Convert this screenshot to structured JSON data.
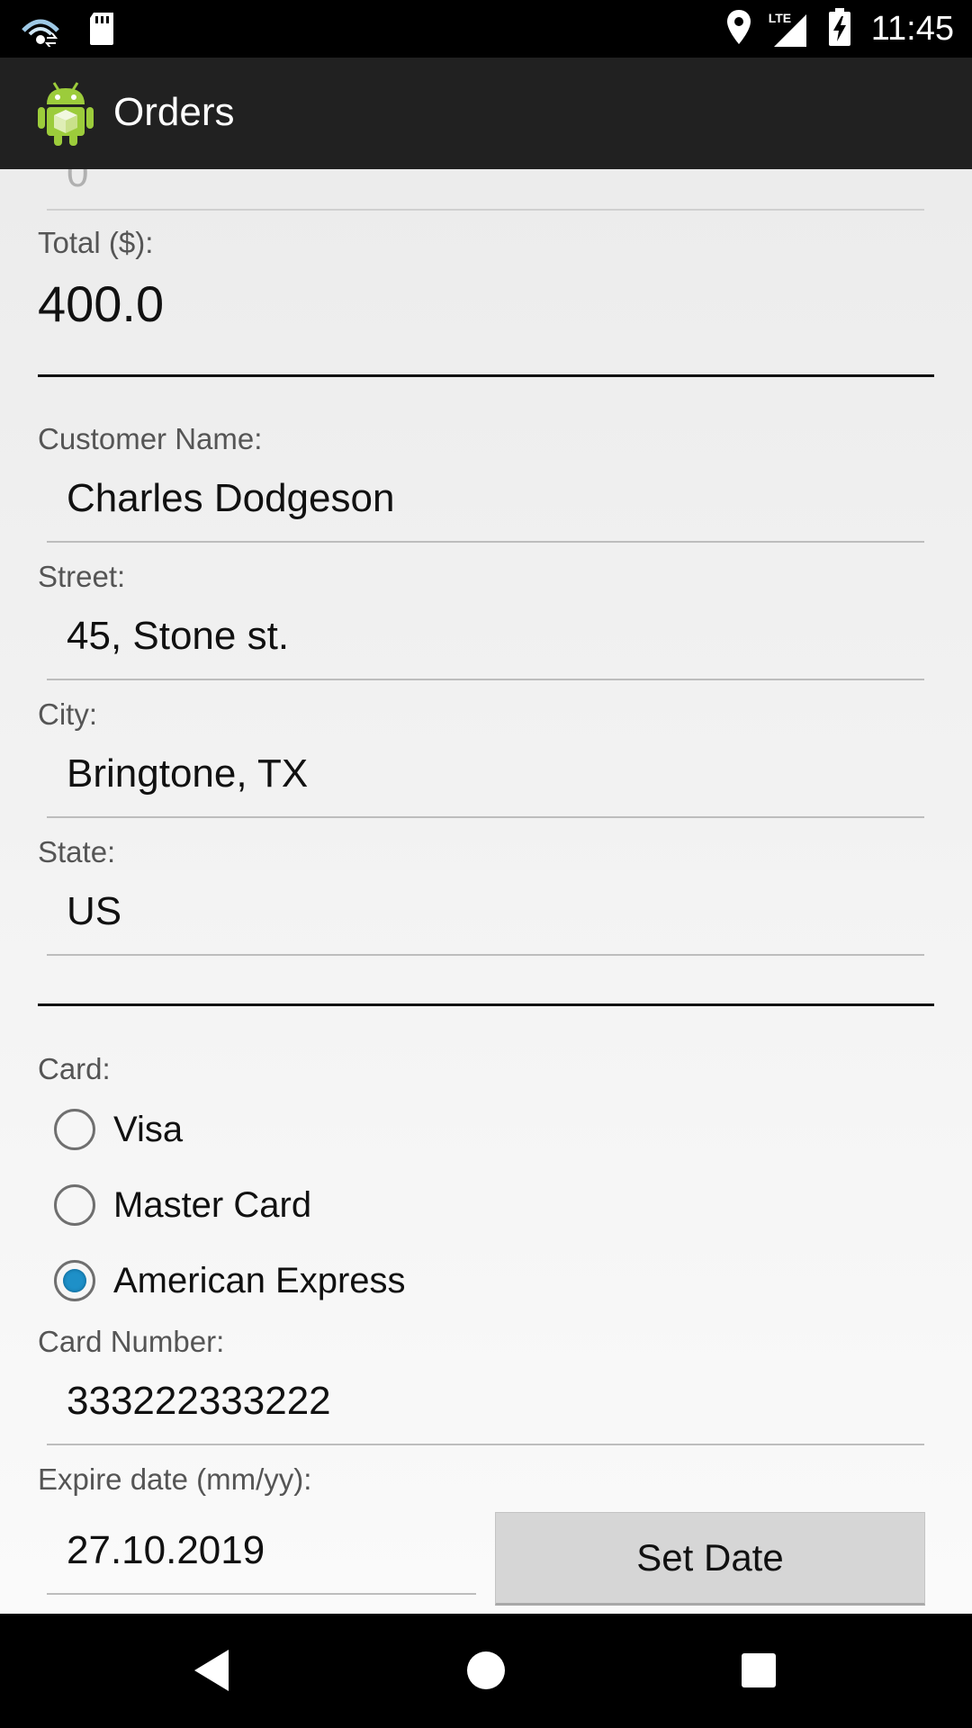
{
  "status_bar": {
    "time": "11:45",
    "network_label": "LTE",
    "icons": [
      "wifi-sync-icon",
      "sd-card-icon",
      "location-icon",
      "signal-icon",
      "battery-charging-icon"
    ]
  },
  "app_bar": {
    "title": "Orders",
    "app_icon": "android-package-icon"
  },
  "form": {
    "partial_field_value": "0",
    "total_label": "Total ($):",
    "total_value": "400.0",
    "customer_name_label": "Customer Name:",
    "customer_name_value": "Charles Dodgeson",
    "street_label": "Street:",
    "street_value": "45, Stone st.",
    "city_label": "City:",
    "city_value": "Bringtone, TX",
    "state_label": "State:",
    "state_value": "US",
    "card_label": "Card:",
    "card_options": [
      {
        "label": "Visa",
        "checked": false
      },
      {
        "label": "Master Card",
        "checked": false
      },
      {
        "label": "American Express",
        "checked": true
      }
    ],
    "card_number_label": "Card Number:",
    "card_number_value": "333222333222",
    "expire_label": "Expire date (mm/yy):",
    "expire_value": "27.10.2019",
    "set_date_label": "Set Date"
  },
  "nav_bar": {
    "buttons": [
      "back-icon",
      "home-icon",
      "recents-icon"
    ]
  },
  "colors": {
    "app_bar": "#212121",
    "radio_accent": "#1e90c8",
    "background": "#f0f0f0"
  }
}
